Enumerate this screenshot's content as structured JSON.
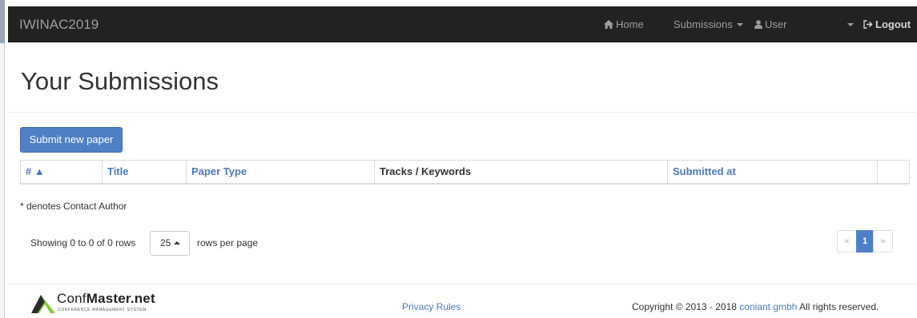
{
  "navbar": {
    "brand": "IWINAC2019",
    "home": "Home",
    "submissions": "Submissions",
    "user": "User",
    "logout": "Logout"
  },
  "page": {
    "title": "Your Submissions",
    "submit_button": "Submit new paper"
  },
  "table": {
    "columns": [
      "# ▲",
      "Title",
      "Paper Type",
      "Tracks / Keywords",
      "Submitted at",
      ""
    ],
    "rows": []
  },
  "note": "* denotes Contact Author",
  "pagination": {
    "showing": "Showing 0 to 0 of 0 rows",
    "page_size": "25",
    "rows_per_page": "rows per page",
    "prev": "«",
    "current": "1",
    "next": "»"
  },
  "footer": {
    "logo_text_1": "Conf",
    "logo_text_2": "Master.net",
    "logo_tagline": "CONFERENCE MANAGEMENT SYSTEM",
    "privacy": "Privacy Rules",
    "copyright_before": "Copyright © 2013 - 2018 ",
    "company": "coniant gmbh",
    "copyright_after": " All rights reserved."
  },
  "colors": {
    "navbar": "#222222",
    "accent": "#4f7fc4",
    "link": "#4b78bd"
  },
  "icons": [
    "home-icon",
    "user-icon",
    "logout-icon",
    "confmaster-logo"
  ]
}
